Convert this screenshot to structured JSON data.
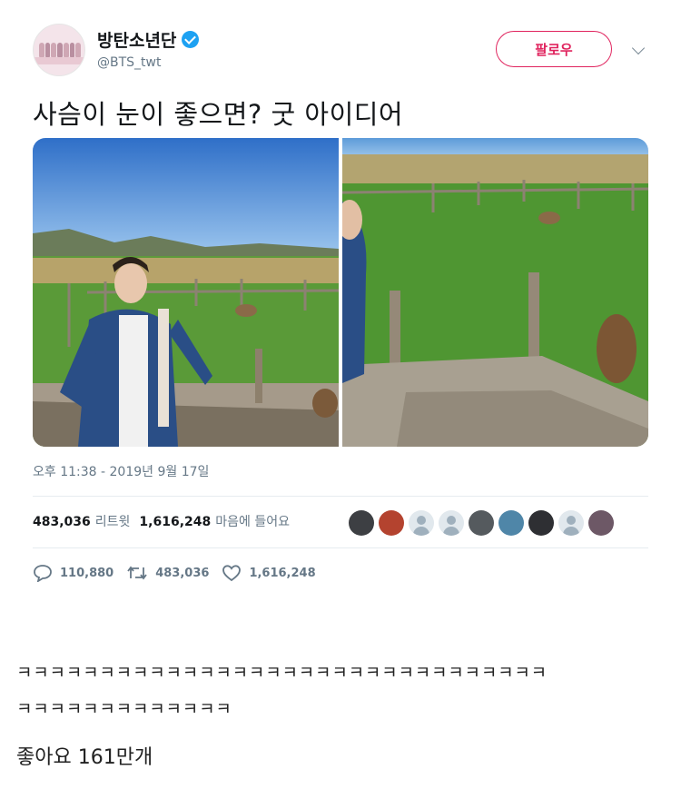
{
  "tweet": {
    "display_name": "방탄소년단",
    "handle": "@BTS_twt",
    "follow_label": "팔로우",
    "text": "사슴이 눈이 좋으면? 굿 아이디어",
    "timestamp": "오후 11:38 - 2019년 9월 17일",
    "stats": {
      "retweets": "483,036",
      "retweets_label": "리트윗",
      "likes": "1,616,248",
      "likes_label": "마음에 들어요"
    },
    "actions": {
      "replies": "110,880",
      "retweets": "483,036",
      "likes": "1,616,248"
    },
    "liker_count": 10,
    "colors": {
      "accent": "#e0245e",
      "verified": "#1da1f2",
      "muted": "#657786"
    }
  },
  "comments": {
    "line1": "ㅋㅋㅋㅋㅋㅋㅋㅋㅋㅋㅋㅋㅋㅋㅋㅋㅋㅋㅋㅋㅋㅋㅋㅋㅋㅋㅋㅋㅋㅋㅋㅋ",
    "line2": "ㅋㅋㅋㅋㅋㅋㅋㅋㅋㅋㅋㅋㅋ",
    "likes_caption": "좋아요 161만개"
  }
}
